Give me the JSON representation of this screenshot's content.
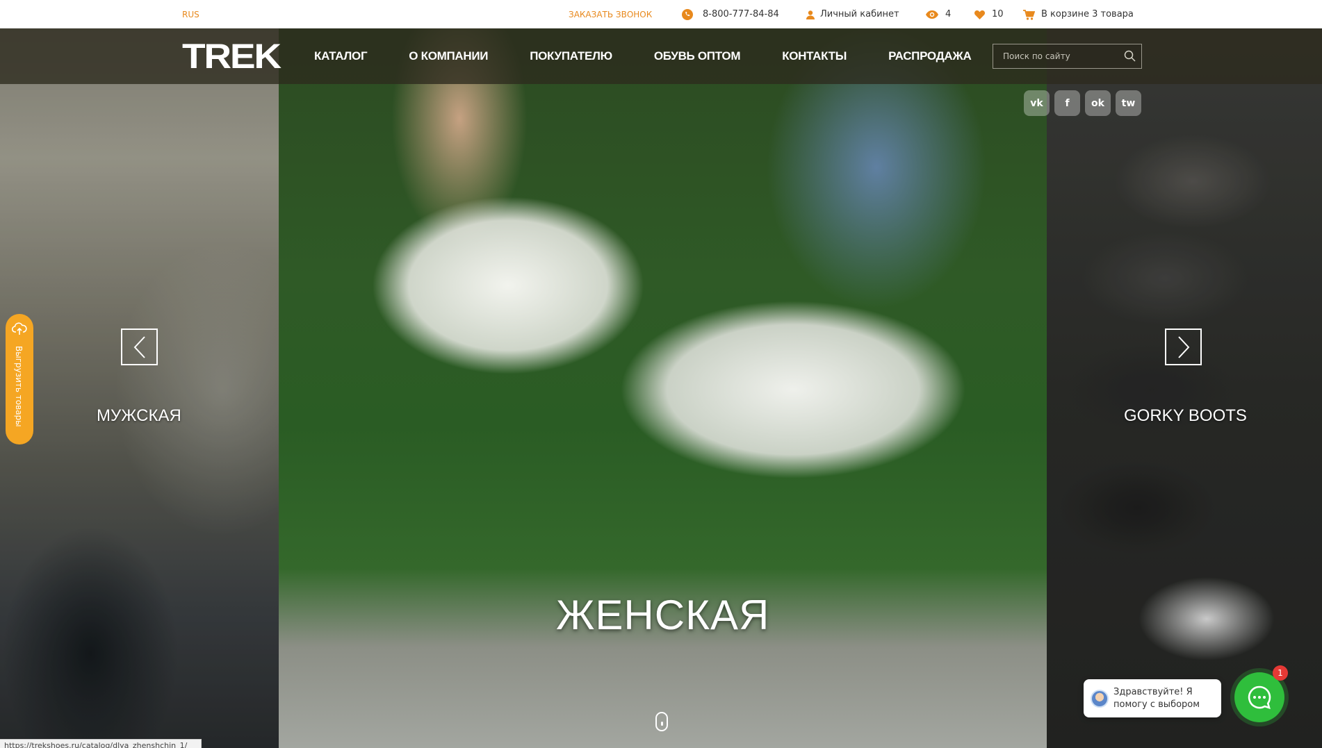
{
  "topbar": {
    "lang": "RUS",
    "callback": "ЗАКАЗАТЬ ЗВОНОК",
    "phone": "8-800-777-84-84",
    "account": "Личный кабинет",
    "views_count": "4",
    "favorites_count": "10",
    "cart": "В корзине 3 товара"
  },
  "header": {
    "logo": "TREK",
    "nav": [
      "КАТАЛОГ",
      "О КОМПАНИИ",
      "ПОКУПАТЕЛЮ",
      "ОБУВЬ ОПТОМ",
      "КОНТАКТЫ",
      "РАСПРОДАЖА"
    ],
    "search_placeholder": "Поиск по сайту"
  },
  "social": [
    {
      "icon": "vk-icon",
      "glyph": "vk"
    },
    {
      "icon": "facebook-icon",
      "glyph": "f"
    },
    {
      "icon": "odnoklassniki-icon",
      "glyph": "ok"
    },
    {
      "icon": "twitter-icon",
      "glyph": "tw"
    }
  ],
  "hero": {
    "left_label": "МУЖСКАЯ",
    "main_label": "ЖЕНСКАЯ",
    "right_label": "GORKY BOOTS"
  },
  "export_tab": {
    "label": "Выгрузить товары"
  },
  "chat": {
    "greeting": "Здравствуйте! Я помогу с выбором",
    "badge": "1"
  },
  "status_url": "https://trekshoes.ru/catalog/dlya_zhenshchin_1/",
  "colors": {
    "accent": "#e8891d",
    "export_tab": "#f5a623",
    "chat": "#2fbe3c",
    "badge": "#e53935"
  }
}
